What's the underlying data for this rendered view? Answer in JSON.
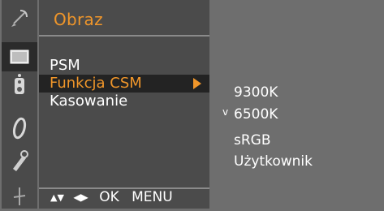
{
  "menu": {
    "title": "Obraz",
    "items": [
      {
        "label": "PSM"
      },
      {
        "label": "Funkcja CSM"
      },
      {
        "label": "Kasowanie"
      }
    ]
  },
  "submenu": {
    "items": [
      {
        "label": "9300K"
      },
      {
        "label": "6500K"
      },
      {
        "label": "sRGB"
      },
      {
        "label": "Użytkownik"
      }
    ],
    "check_mark": "v"
  },
  "footer": {
    "nav_glyph": "▲▼",
    "lr_glyph": "◀▶",
    "ok_label": "OK",
    "menu_label": "MENU"
  },
  "icons": [
    "satellite-icon",
    "picture-icon",
    "audio-icon",
    "time-icon",
    "option-icon",
    "setup-icon"
  ],
  "colors": {
    "accent": "#f0962a",
    "panel": "#4b4b4b",
    "background": "#6e6e6e",
    "selected": "#232323"
  }
}
